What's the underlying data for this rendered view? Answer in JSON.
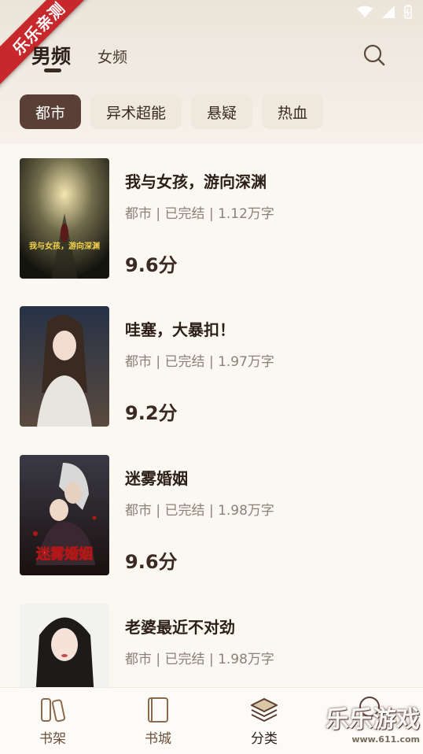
{
  "ribbon": "乐乐亲测",
  "header": {
    "tabs": [
      {
        "label": "男频"
      },
      {
        "label": "女频"
      }
    ],
    "categories": [
      {
        "label": "都市"
      },
      {
        "label": "异术超能"
      },
      {
        "label": "悬疑"
      },
      {
        "label": "热血"
      }
    ]
  },
  "books": [
    {
      "title": "我与女孩，游向深渊",
      "meta": "都市 | 已完结 | 1.12万字",
      "score": "9.6分",
      "cover_text": "我与女孩，游向深渊"
    },
    {
      "title": "哇塞，大暴扣！",
      "meta": "都市 | 已完结 | 1.97万字",
      "score": "9.2分"
    },
    {
      "title": "迷雾婚姻",
      "meta": "都市 | 已完结 | 1.98万字",
      "score": "9.6分",
      "cover_text": "迷雾婚姻"
    },
    {
      "title": "老婆最近不对劲",
      "meta": "都市 | 已完结 | 1.98万字",
      "score": ""
    }
  ],
  "nav": [
    {
      "label": "书架"
    },
    {
      "label": "书城"
    },
    {
      "label": "分类"
    },
    {
      "label": ""
    }
  ],
  "watermark": {
    "text": "乐乐游戏",
    "url": "www.611.com"
  },
  "colors": {
    "accent": "#5a3f36",
    "chip_bg": "#efe8dc",
    "ribbon": "#c7282b"
  }
}
